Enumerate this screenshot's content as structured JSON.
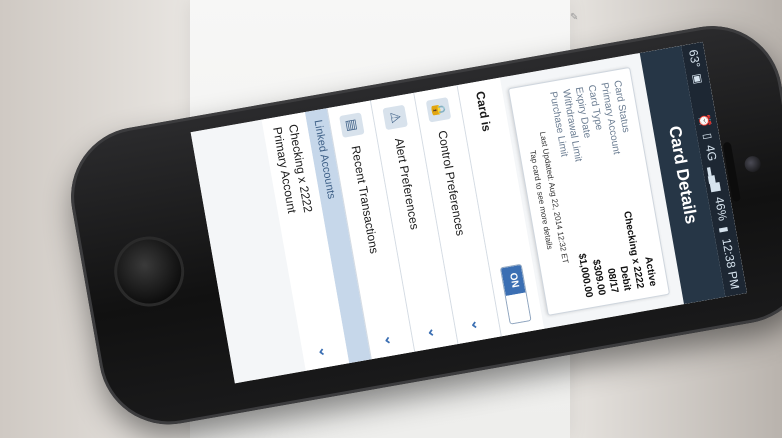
{
  "status_bar": {
    "temperature": "63°",
    "network": "4G",
    "battery": "46%",
    "time": "12:38 PM"
  },
  "title": "Card Details",
  "card": {
    "rows": [
      {
        "label": "Card Status",
        "value": "Active"
      },
      {
        "label": "Primary Account",
        "value": "Checking x 2222"
      },
      {
        "label": "Card Type",
        "value": "Debit"
      },
      {
        "label": "Expiry Date",
        "value": "08/17"
      },
      {
        "label": "Withdrawal Limit",
        "value": "$309.00"
      },
      {
        "label": "Purchase Limit",
        "value": "$1,000.00"
      }
    ],
    "last_updated": "Last Updated: Aug 22, 2014 12:32 ET",
    "hint": "Tap card to see more details"
  },
  "card_is": {
    "label": "Card is",
    "toggle": "ON"
  },
  "menu": [
    {
      "label": "Control Preferences",
      "icon": "lock-icon"
    },
    {
      "label": "Alert Preferences",
      "icon": "alert-icon"
    },
    {
      "label": "Recent Transactions",
      "icon": "transactions-icon"
    }
  ],
  "linked_accounts": {
    "header": "Linked Accounts",
    "line1": "Checking x 2222",
    "line2": "Primary Account"
  }
}
